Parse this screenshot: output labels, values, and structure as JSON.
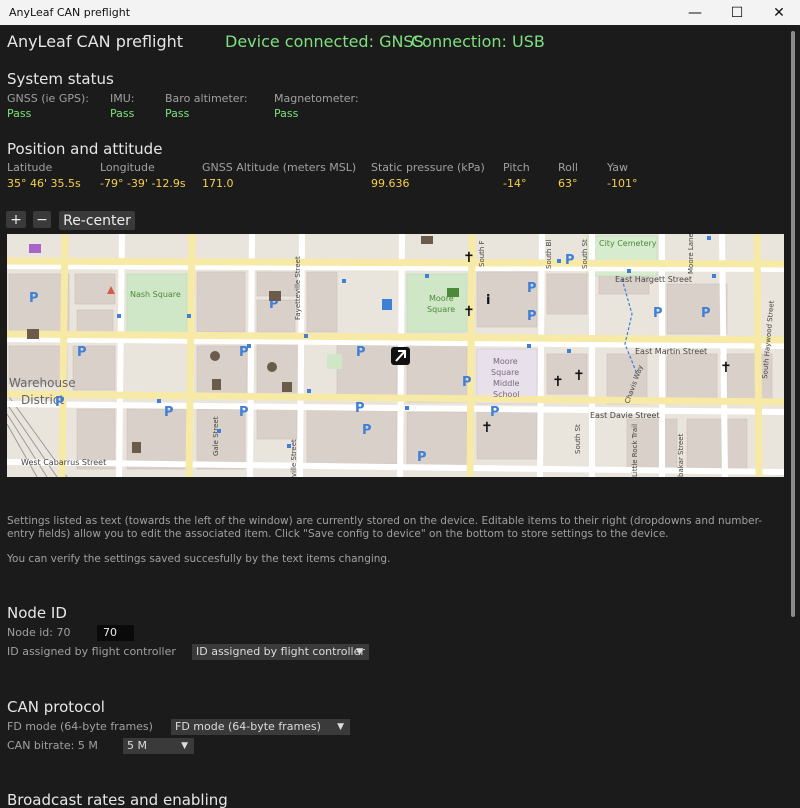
{
  "window": {
    "title": "AnyLeaf CAN preflight",
    "controls": {
      "minimize": "—",
      "maximize": "☐",
      "close": "✕"
    }
  },
  "header": {
    "app_title": "AnyLeaf CAN preflight",
    "device_status": "Device connected: GNSS",
    "connection": "Connection: USB"
  },
  "system_status": {
    "heading": "System status",
    "items": [
      {
        "label": "GNSS (ie GPS):",
        "value": "Pass"
      },
      {
        "label": "IMU:",
        "value": "Pass"
      },
      {
        "label": "Baro altimeter:",
        "value": "Pass"
      },
      {
        "label": "Magnetometer:",
        "value": "Pass"
      }
    ]
  },
  "position": {
    "heading": "Position and attitude",
    "items": [
      {
        "label": "Latitude",
        "value": "35° 46' 35.5s"
      },
      {
        "label": "Longitude",
        "value": "-79° -39' -12.9s"
      },
      {
        "label": "GNSS Altitude (meters MSL)",
        "value": "171.0"
      },
      {
        "label": "Static pressure (kPa)",
        "value": "99.636"
      },
      {
        "label": "Pitch",
        "value": "-14°"
      },
      {
        "label": "Roll",
        "value": "63°"
      },
      {
        "label": "Yaw",
        "value": "-101°"
      }
    ]
  },
  "map_controls": {
    "zoom_in": "+",
    "zoom_out": "−",
    "recenter": "Re-center"
  },
  "map": {
    "labels": {
      "warehouse": "Warehouse",
      "district": "District",
      "nash_square": "Nash Square",
      "moore_square_1": "Moore",
      "moore_square_2": "Square",
      "moore_middle_1": "Moore",
      "moore_middle_2": "Square",
      "moore_middle_3": "Middle",
      "moore_middle_4": "School",
      "city_cemetery": "City Cemetery",
      "east_hargett": "East Hargett Street",
      "east_martin": "East Martin Street",
      "east_davie": "East Davie Street",
      "west_cabarrus": "West Cabarrus Street",
      "fayetteville_1": "Fayetteville Street",
      "fayetteville_2": "ville Street",
      "gale": "Gale Street",
      "chavis": "Chavis Way",
      "south_haywood": "South Haywood Street",
      "moore_lane": "Moore Lane",
      "south_bl": "South Bl",
      "south_st": "South St",
      "south_f": "South F",
      "south_st2": "South St",
      "little_rock": "Little Rock Trail",
      "bakar": "bakar Street"
    },
    "icons": {
      "parking": "P",
      "church": "✝",
      "info": "i",
      "tree": "♠"
    }
  },
  "intro": {
    "paragraph1": "Settings listed as text (towards the left of the window) are currently stored on the device. Editable items to their right (dropdowns and number-entry fields) allow you to edit the associated item. Click \"Save config to device\" on the bottom to store settings to the device.",
    "paragraph2": "You can verify the settings saved succesfully by the text items changing."
  },
  "node_id": {
    "heading": "Node ID",
    "current_label": "Node id: 70",
    "input_value": "70",
    "assign_label": "ID assigned by flight controller",
    "assign_select": "ID assigned by flight controller"
  },
  "can_protocol": {
    "heading": "CAN protocol",
    "fd_label": "FD mode (64-byte frames)",
    "fd_select": "FD mode (64-byte frames)",
    "bitrate_label": "CAN bitrate: 5 M",
    "bitrate_select": "5 M"
  },
  "broadcast": {
    "heading": "Broadcast rates and enabling"
  },
  "colors": {
    "background": "#1b1b1b",
    "pass": "#7ee07e",
    "value": "#f5d14a",
    "label": "#a0a0a0"
  }
}
